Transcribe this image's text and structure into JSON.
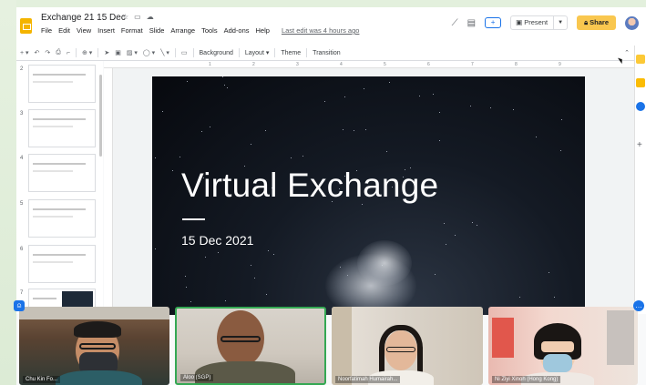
{
  "app": {
    "doc_title": "Exchange 21 15 Dec",
    "menu": [
      "File",
      "Edit",
      "View",
      "Insert",
      "Format",
      "Slide",
      "Arrange",
      "Tools",
      "Add-ons",
      "Help"
    ],
    "last_edit": "Last edit was 4 hours ago",
    "present_label": "Present",
    "share_label": "Share"
  },
  "toolbar": {
    "background": "Background",
    "layout": "Layout",
    "theme": "Theme",
    "transition": "Transition"
  },
  "ruler": [
    "1",
    "2",
    "3",
    "4",
    "5",
    "6",
    "7",
    "8",
    "9"
  ],
  "filmstrip": {
    "slide_numbers": [
      "2",
      "3",
      "4",
      "5",
      "6",
      "7"
    ]
  },
  "slide": {
    "title": "Virtual Exchange",
    "date": "15 Dec 2021"
  },
  "participants": [
    {
      "name": "Chu Kin Fo..."
    },
    {
      "name": "Aloo (SGP)"
    },
    {
      "name": "Noorfatimah Humairah..."
    },
    {
      "name": "Ni Ziyi Xinoh (Hong Kong)"
    }
  ],
  "colors": {
    "share_button": "#f9c74f",
    "slide_bg": "#0b0f16",
    "active_speaker_border": "#34a853",
    "accent": "#1a73e8"
  }
}
